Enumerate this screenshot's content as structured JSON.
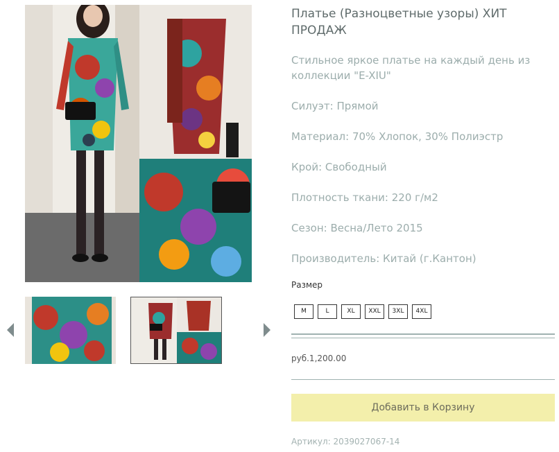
{
  "product": {
    "title": "Платье (Разноцветные узоры) ХИТ ПРОДАЖ",
    "description": "Стильное яркое платье на каждый день из коллекции \"E-XIU\"",
    "silhouette": "Силуэт: Прямой",
    "material": "Материал: 70% Хлопок, 30% Полиэстр",
    "cut": "Крой: Свободный",
    "density": "Плотность ткани: 220 г/м2",
    "season": "Сезон: Весна/Лето 2015",
    "manufacturer": "Производитель: Китай (г.Кантон)"
  },
  "size": {
    "label": "Размер",
    "options": [
      "M",
      "L",
      "XL",
      "XXL",
      "3XL",
      "4XL"
    ]
  },
  "price": "руб.1,200.00",
  "cart": {
    "button_label": "Добавить в Корзину"
  },
  "sku": "Артикул: 2039027067-14",
  "gallery": {
    "prev_icon": "chevron-left-icon",
    "next_icon": "chevron-right-icon"
  },
  "colors": {
    "title": "#5f6b6b",
    "description": "#9cadac",
    "cart_button": "#f3efab",
    "separator": "#9fb1b0",
    "arrow": "#7f8c8d"
  }
}
